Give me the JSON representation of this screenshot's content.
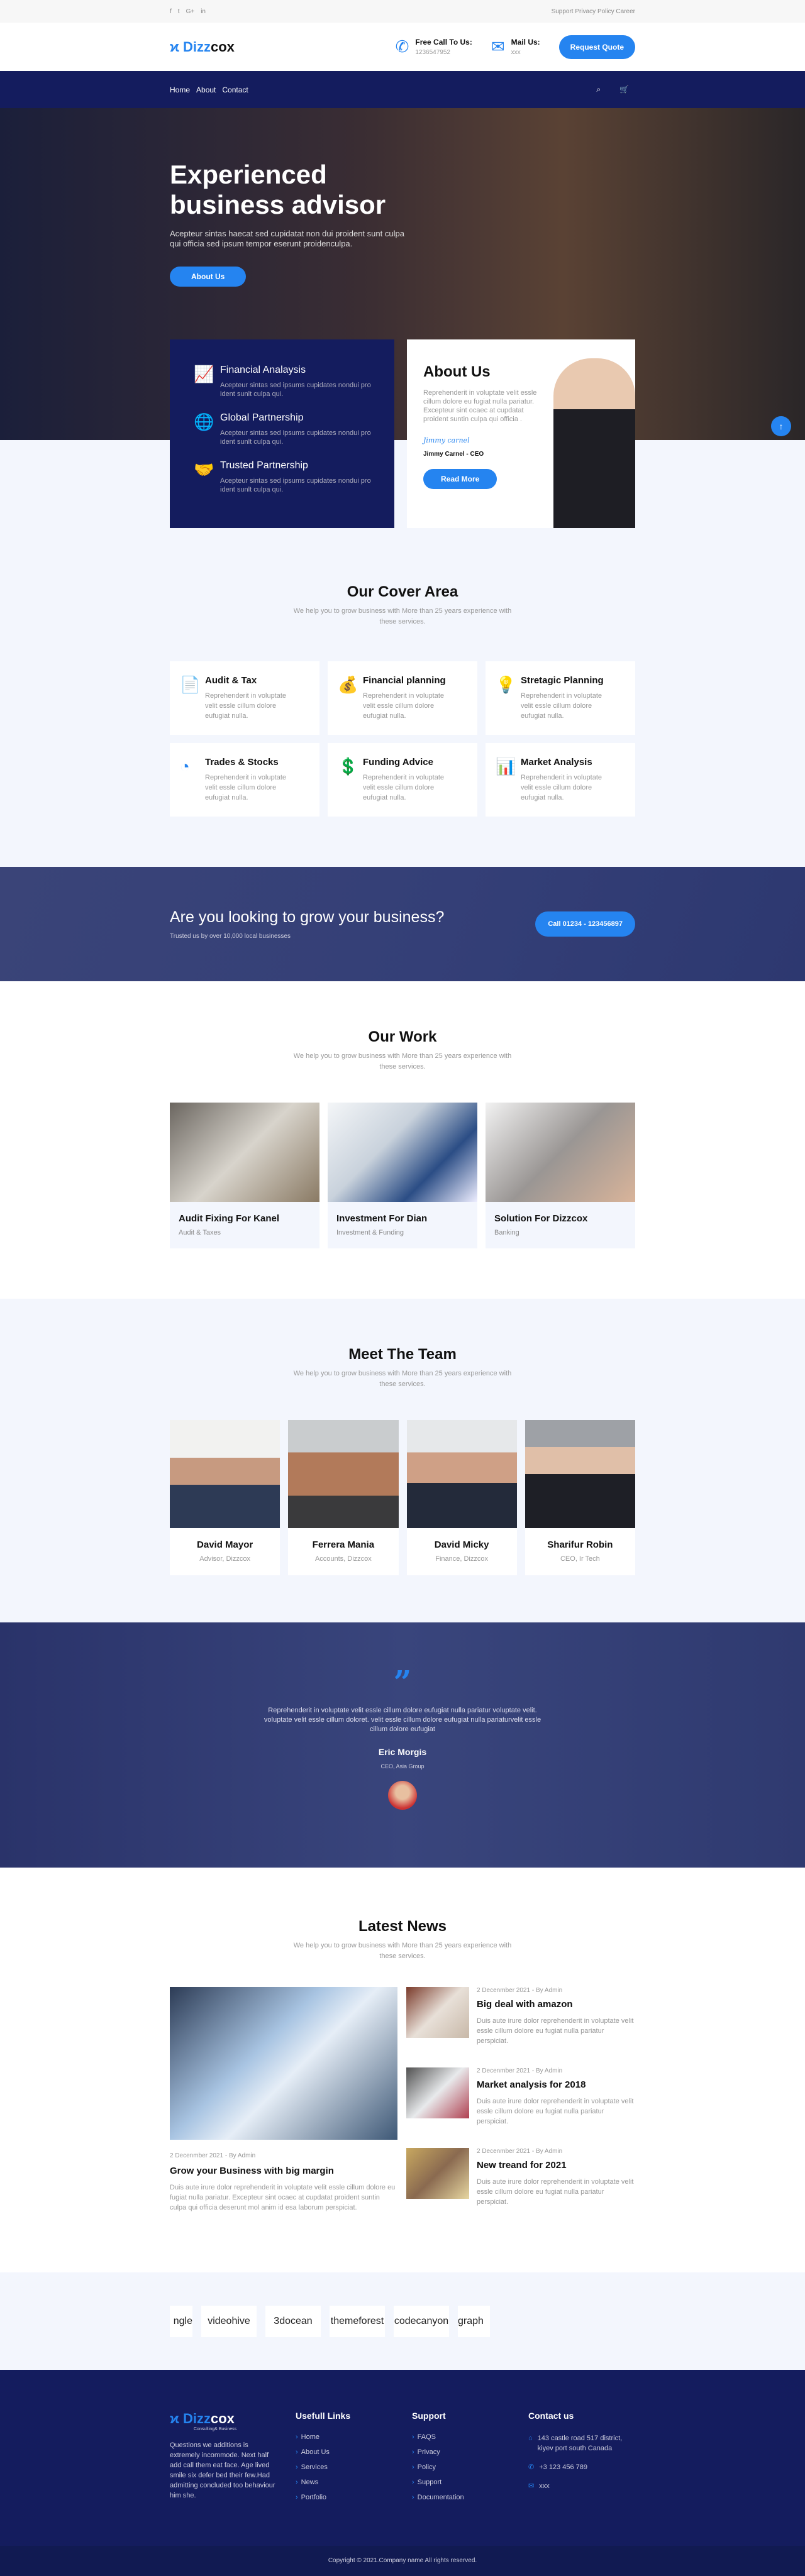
{
  "topbar": {
    "social": [
      "f",
      "t",
      "G+",
      "in"
    ],
    "links": [
      "Support",
      "Privacy",
      "Policy",
      "Career"
    ]
  },
  "header": {
    "logo_a": "Dizz",
    "logo_b": "cox",
    "call_title": "Free Call To Us:",
    "call_value": "1236547952",
    "mail_title": "Mail Us:",
    "mail_value": "xxx",
    "quote_btn": "Request Quote"
  },
  "nav": {
    "items": [
      "Home",
      "About",
      "Contact"
    ]
  },
  "hero": {
    "title_line1": "Experienced",
    "title_line2": "business advisor",
    "text": "Acepteur sintas haecat sed cupidatat non dui proident sunt culpa qui officia sed ipsum tempor eserunt proidenculpa.",
    "button": "About Us"
  },
  "features": [
    {
      "icon": "chart-icon",
      "title": "Financial Analaysis",
      "text": "Acepteur sintas sed ipsums cupidates nondui pro ident sunlt culpa qui."
    },
    {
      "icon": "globe-icon",
      "title": "Global Partnership",
      "text": "Acepteur sintas sed ipsums cupidates nondui pro ident sunlt culpa qui."
    },
    {
      "icon": "handshake-icon",
      "title": "Trusted Partnership",
      "text": "Acepteur sintas sed ipsums cupidates nondui pro ident sunlt culpa qui."
    }
  ],
  "about": {
    "title": "About Us",
    "text": "Reprehenderit in voluptate velit essle cillum dolore eu fugiat nulla pariatur. Excepteur sint ocaec at cupdatat proident suntin culpa qui officia .",
    "signature": "Jimmy carnel",
    "name": "Jimmy Carnel - CEO",
    "button": "Read More"
  },
  "cover": {
    "title": "Our Cover Area",
    "subtitle": "We help you to grow business with More than 25 years experience with these services.",
    "items": [
      {
        "icon": "document-icon",
        "title": "Audit & Tax",
        "text": "Reprehenderit in voluptate velit essle cillum dolore eufugiat nulla."
      },
      {
        "icon": "money-hand-icon",
        "title": "Financial planning",
        "text": "Reprehenderit in voluptate velit essle cillum dolore eufugiat nulla."
      },
      {
        "icon": "lightbulb-icon",
        "title": "Stretagic Planning",
        "text": "Reprehenderit in voluptate velit essle cillum dolore eufugiat nulla."
      },
      {
        "icon": "pie-chart-icon",
        "title": "Trades & Stocks",
        "text": "Reprehenderit in voluptate velit essle cillum dolore eufugiat nulla."
      },
      {
        "icon": "money-bag-icon",
        "title": "Funding Advice",
        "text": "Reprehenderit in voluptate velit essle cillum dolore eufugiat nulla."
      },
      {
        "icon": "market-icon",
        "title": "Market Analysis",
        "text": "Reprehenderit in voluptate velit essle cillum dolore eufugiat nulla."
      }
    ]
  },
  "cta": {
    "title": "Are you looking to grow your business?",
    "subtitle": "Trusted us by over 10,000 local businesses",
    "button": "Call 01234 - 123456897"
  },
  "work": {
    "title": "Our Work",
    "subtitle": "We help you to grow business with More than 25 years experience with these services.",
    "items": [
      {
        "title": "Audit Fixing For Kanel",
        "cat": "Audit & Taxes"
      },
      {
        "title": "Investment For Dian",
        "cat": "Investment & Funding"
      },
      {
        "title": "Solution For Dizzcox",
        "cat": "Banking"
      }
    ]
  },
  "team": {
    "title": "Meet The Team",
    "subtitle": "We help you to grow business with More than 25 years experience with these services.",
    "members": [
      {
        "name": "David Mayor",
        "role": "Advisor, Dizzcox"
      },
      {
        "name": "Ferrera Mania",
        "role": "Accounts, Dizzcox"
      },
      {
        "name": "David Micky",
        "role": "Finance, Dizzcox"
      },
      {
        "name": "Sharifur Robin",
        "role": "CEO, Ir Tech"
      }
    ]
  },
  "testimonial": {
    "text": "Reprehenderit in voluptate velit essle cillum dolore eufugiat nulla pariatur voluptate velit. voluptate velit essle cillum doloret. velit essle cillum dolore eufugiat nulla pariaturvelit essle cillum dolore eufugiat",
    "name": "Eric Morgis",
    "role": "CEO, Asia Group"
  },
  "news": {
    "title": "Latest News",
    "subtitle": "We help you to grow business with More than 25 years experience with these services.",
    "featured": {
      "meta": "2 Decenmber 2021  -  By Admin",
      "title": "Grow your Business with big margin",
      "text": "Duis aute irure dolor reprehenderit in voluptate velit essle cillum dolore eu fugiat nulla pariatur. Excepteur sint ocaec at cupdatat proident suntin culpa qui officia deserunt mol anim id esa laborum perspiciat."
    },
    "items": [
      {
        "meta": "2 Decenmber 2021  -  By Admin",
        "title": "Big deal with amazon",
        "text": "Duis aute irure dolor reprehenderit in voluptate velit essle cillum dolore eu fugiat nulla pariatur perspiciat."
      },
      {
        "meta": "2 Decenmber 2021  -  By Admin",
        "title": "Market analysis for 2018",
        "text": "Duis aute irure dolor reprehenderit in voluptate velit essle cillum dolore eu fugiat nulla pariatur perspiciat."
      },
      {
        "meta": "2 Decenmber 2021  -  By Admin",
        "title": "New treand for 2021",
        "text": "Duis aute irure dolor reprehenderit in voluptate velit essle cillum dolore eu fugiat nulla pariatur perspiciat."
      }
    ]
  },
  "brands": [
    "ngle",
    "videohive",
    "3docean",
    "themeforest",
    "codecanyon",
    "graph"
  ],
  "footer": {
    "logo_a": "Dizz",
    "logo_b": "cox",
    "tagline": "Consulting& Business",
    "about": "Questions we additions is extremely incommode. Next half add call them eat face. Age lived smile six defer bed their few.Had admitting concluded too behaviour him she.",
    "links_title": "Usefull Links",
    "links": [
      "Home",
      "About Us",
      "Services",
      "News",
      "Portfolio"
    ],
    "support_title": "Support",
    "support": [
      "FAQS",
      "Privacy",
      "Policy",
      "Support",
      "Documentation"
    ],
    "contact_title": "Contact us",
    "address": "143 castle road 517 district, kiyev port south Canada",
    "phone": "+3 123 456 789",
    "email": "xxx",
    "copyright": "Copyright © 2021.Company name All rights reserved."
  },
  "colors": {
    "accent": "#2584f0",
    "navy": "#141c5e",
    "light_bg": "#f3f6fd"
  }
}
